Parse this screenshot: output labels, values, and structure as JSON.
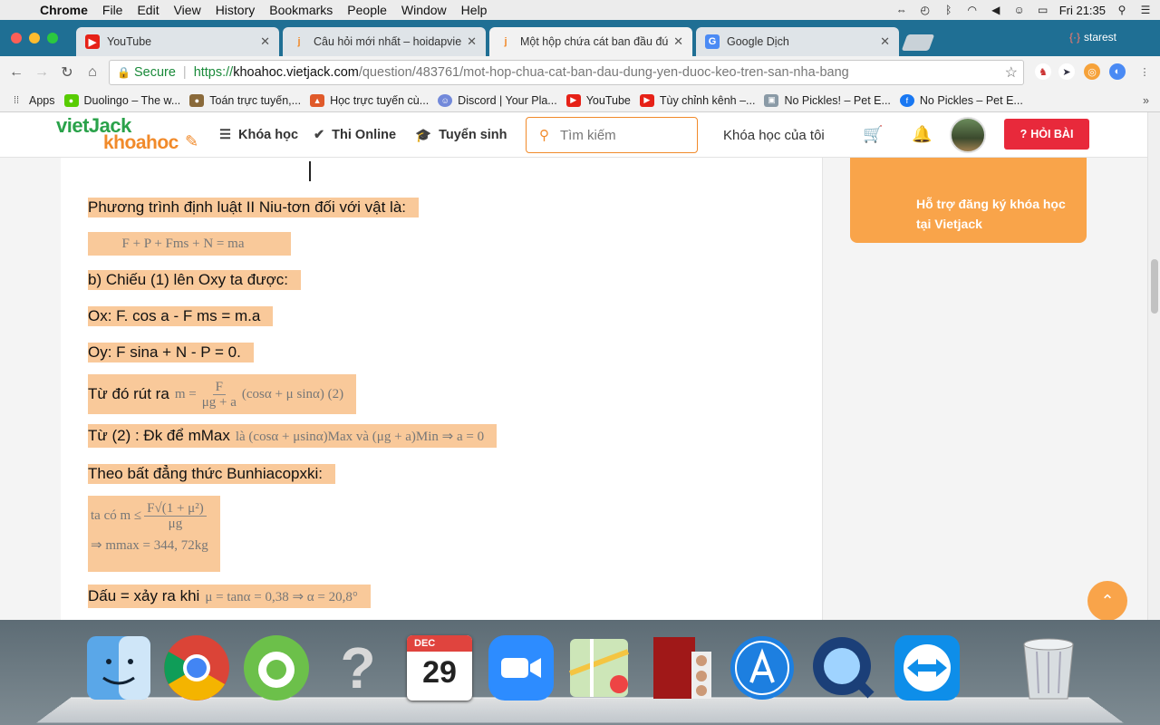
{
  "menubar": {
    "app": "Chrome",
    "items": [
      "File",
      "Edit",
      "View",
      "History",
      "Bookmarks",
      "People",
      "Window",
      "Help"
    ],
    "clock": "Fri 21:35"
  },
  "tabs": [
    {
      "label": "YouTube",
      "active": false
    },
    {
      "label": "Câu hỏi mới nhất – hoidapviet",
      "active": false
    },
    {
      "label": "Một hộp chứa cát ban đầu đứ",
      "active": true
    },
    {
      "label": "Google Dịch",
      "active": false
    }
  ],
  "profile": "starest",
  "omnibox": {
    "secure_label": "Secure",
    "scheme": "https://",
    "host": "khoahoc.vietjack.com",
    "path": "/question/483761/mot-hop-chua-cat-ban-dau-dung-yen-duoc-keo-tren-san-nha-bang"
  },
  "bookmarks": [
    "Apps",
    "Duolingo – The w...",
    "Toán trực tuyến,...",
    "Học trực tuyến cù...",
    "Discord | Your Pla...",
    "YouTube",
    "Tùy chỉnh kênh –...",
    "No Pickles! – Pet E...",
    "No Pickles – Pet E..."
  ],
  "site": {
    "logo_top": "vietJack",
    "logo_bottom": "khoahoc",
    "nav": [
      "Khóa học",
      "Thi Online",
      "Tuyển sinh"
    ],
    "search_placeholder": "Tìm kiếm",
    "my_courses": "Khóa học của tôi",
    "ask_button": "HỎI BÀI",
    "sidebar_text": "Hỗ trợ đăng ký khóa học tại Vietjack"
  },
  "solution": {
    "l1": "Phương trình định luật II Niu-tơn đối với vật là:",
    "l2": "F + P + Fms + N = ma",
    "l3": "b) Chiếu (1) lên Oxy ta được:",
    "l4": "Ox: F. cos a - F ms = m.a",
    "l5": "Oy: F sina + N - P = 0.",
    "l6_text": "Từ đó rút ra",
    "l6_math_left": "m =",
    "l6_num": "F",
    "l6_den": "μg + a",
    "l6_math_right": "(cosα + μ sinα)  (2)",
    "l7_text": "Từ (2) : Đk để mMax",
    "l7_math": "là  (cosα + μsinα)Max  và  (μg + a)Min ⇒ a = 0",
    "l8": "Theo bất đẳng thức Bunhiacopxki:",
    "l9_left": "ta có  m ≤",
    "l9_num": "F√(1 + μ²)",
    "l9_den": "μg",
    "l10": "⇒ mmax = 344, 72kg",
    "l11_text": "Dấu = xảy ra khi",
    "l11_math": "μ = tanα = 0,38 ⇒ α = 20,8°"
  },
  "dock": [
    "finder",
    "chrome",
    "coc-coc",
    "unknown-app",
    "calendar",
    "zoom",
    "maps",
    "photo-booth",
    "app-store",
    "quicktime",
    "teamviewer",
    "trash"
  ],
  "calendar": {
    "month": "DEC",
    "day": "29"
  }
}
